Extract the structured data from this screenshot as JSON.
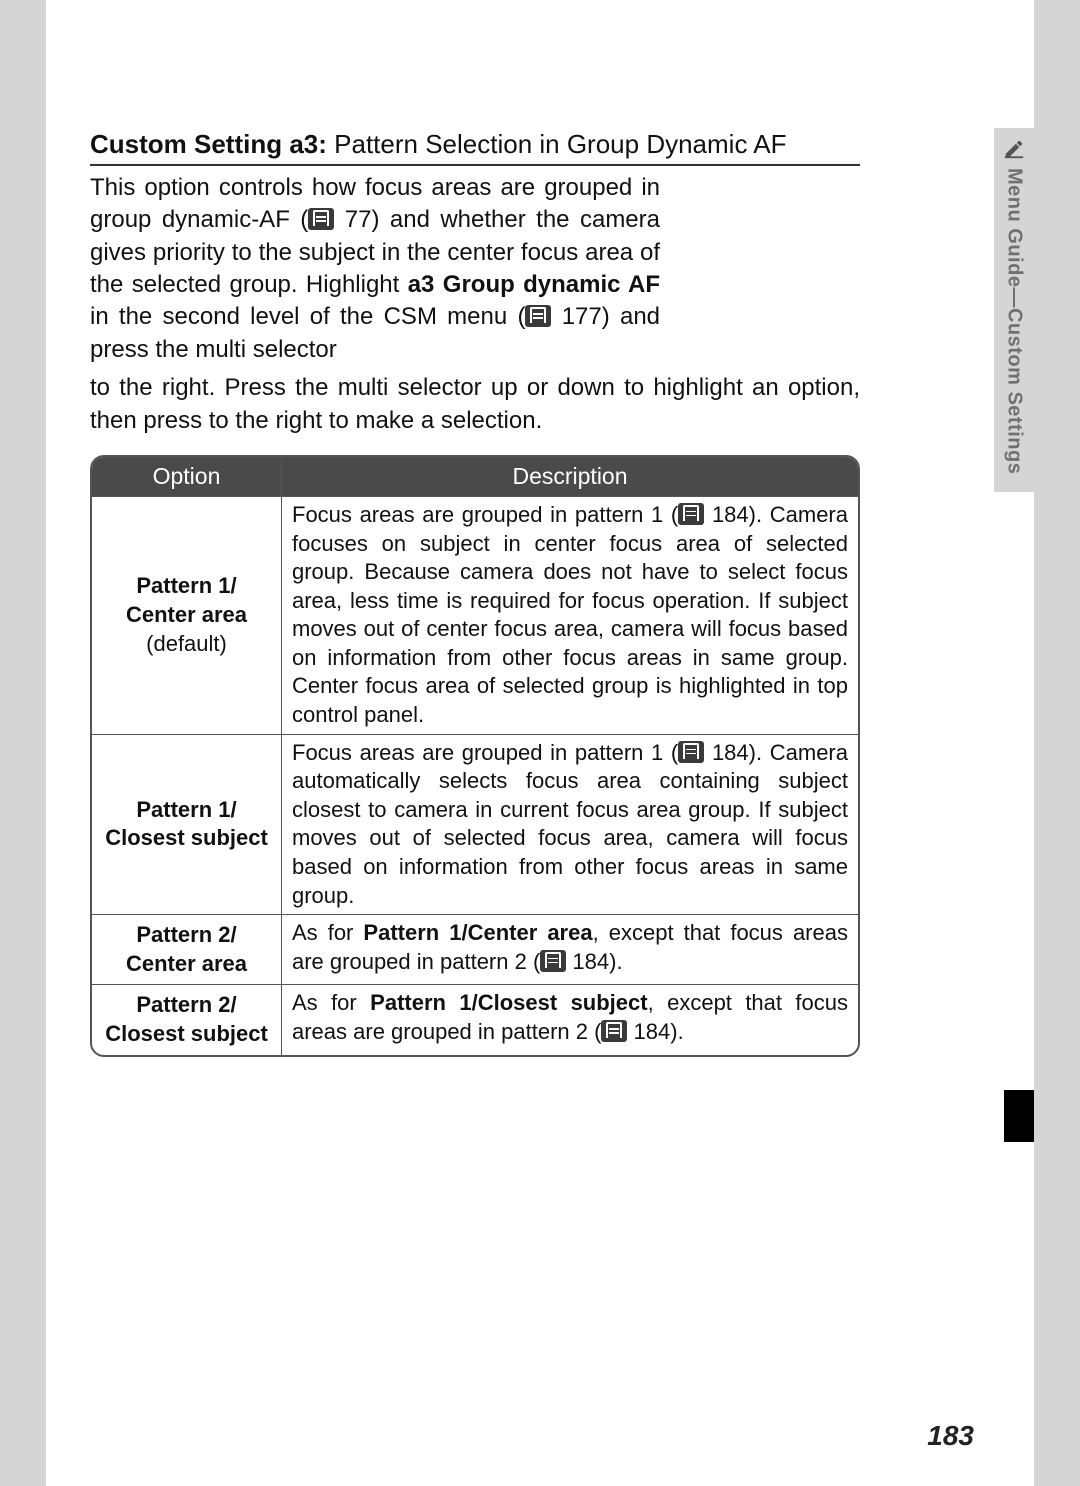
{
  "sideTab": {
    "label": "Menu Guide—Custom Settings"
  },
  "heading": {
    "bold": "Custom Setting a3:",
    "rest": " Pattern Selection in Group Dynamic AF"
  },
  "para": {
    "p1a": "This option controls how focus areas are grouped in group dynamic-AF (",
    "p1_ref1": "77",
    "p1b": ") and whether the camera gives priority to the subject in the center focus area of the selected group.  Highlight ",
    "p1_bold": "a3 Group dynamic AF",
    "p1c": " in the second level of the CSM menu (",
    "p1_ref2": "177",
    "p1d": ") and press the multi selector",
    "p2": "to the right.  Press the multi selector up or down to highlight an option, then press to the right to make a selection."
  },
  "table": {
    "headers": {
      "c1": "Option",
      "c2": "Description"
    },
    "rows": [
      {
        "opt_b1": "Pattern 1/",
        "opt_b2": "Center area",
        "opt_n": "(default)",
        "desc_a": "Focus areas are grouped in pattern 1 (",
        "desc_ref": "184",
        "desc_b": ").  Camera focuses on subject in center focus area of selected group.  Because camera does not have to select focus area, less time is required for focus operation.  If subject moves out of center focus area, camera will focus based on information from other focus areas in same group.  Center focus area of selected group is highlighted in top control panel."
      },
      {
        "opt_b1": "Pattern 1/",
        "opt_b2": "Closest subject",
        "opt_n": "",
        "desc_a": "Focus areas are grouped in pattern 1 (",
        "desc_ref": "184",
        "desc_b": ").  Camera automatically selects focus area containing subject closest to camera in current focus area group.  If subject moves out of selected focus area, camera will focus based on information from other focus areas in same group."
      },
      {
        "opt_b1": "Pattern 2/",
        "opt_b2": "Center area",
        "opt_n": "",
        "desc_a": "As for ",
        "desc_bold": "Pattern 1/Center area",
        "desc_c": ", except that focus areas are grouped in pattern 2 (",
        "desc_ref": "184",
        "desc_d": ")."
      },
      {
        "opt_b1": "Pattern 2/",
        "opt_b2": "Closest subject",
        "opt_n": "",
        "desc_a": "As for ",
        "desc_bold": "Pattern 1/Closest subject",
        "desc_c": ", except that focus areas are grouped in pattern 2 (",
        "desc_ref": "184",
        "desc_d": ")."
      }
    ]
  },
  "pageNumber": "183"
}
